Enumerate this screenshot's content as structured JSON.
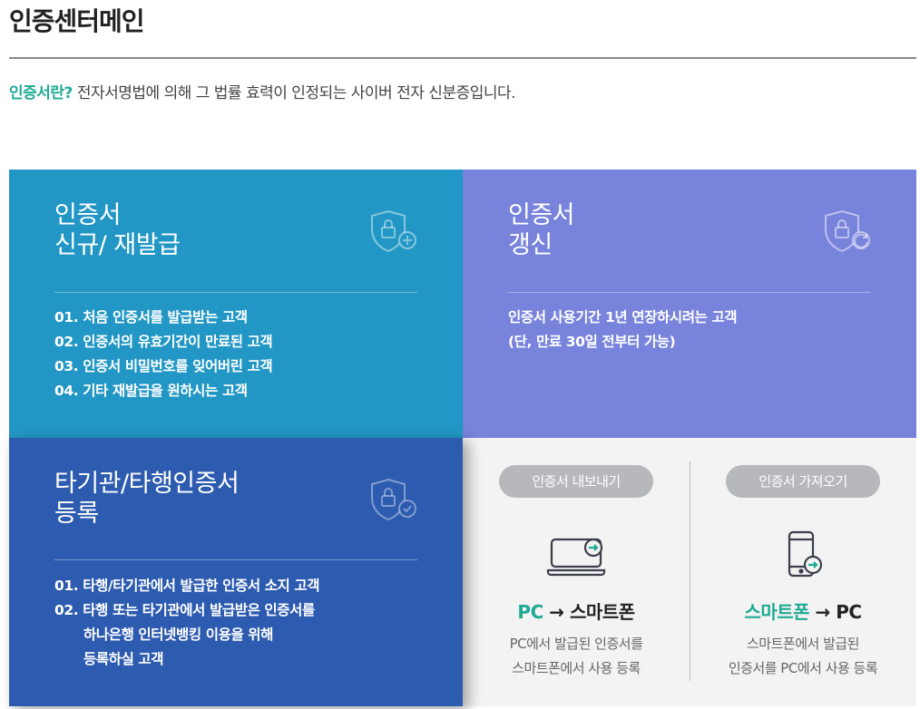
{
  "header": {
    "title": "인증센터메인",
    "intro_label": "인증서란?",
    "intro_text": " 전자서명법에 의해 그 법률 효력이 인정되는 사이버 전자 신분증입니다."
  },
  "cards": {
    "new": {
      "title_line1": "인증서",
      "title_line2": "신규/ 재발급",
      "items": [
        {
          "num": "01.",
          "text": "처음 인증서를 발급받는 고객"
        },
        {
          "num": "02.",
          "text": "인증서의 유효기간이 만료된 고객"
        },
        {
          "num": "03.",
          "text": "인증서 비밀번호를 잊어버린 고객"
        },
        {
          "num": "04.",
          "text": "기타 재발급을 원하시는 고객"
        }
      ]
    },
    "renew": {
      "title_line1": "인증서",
      "title_line2": "갱신",
      "lines": [
        "인증서 사용기간 1년 연장하시려는 고객",
        "(단, 만료 30일 전부터 가능)"
      ]
    },
    "register": {
      "title_line1": "타기관/타행인증서",
      "title_line2": "등록",
      "item1": {
        "num": "01.",
        "text": "타행/타기관에서 발급한 인증서 소지 고객"
      },
      "item2": {
        "num": "02.",
        "text": "타행 또는 타기관에서 발급받은 인증서를",
        "cont1": "하나은행 인터넷뱅킹 이용을 위해",
        "cont2": "등록하실 고객"
      }
    },
    "transfer": {
      "export": {
        "pill": "인증서 내보내기",
        "title_from": "PC",
        "arrow": " → ",
        "title_to": "스마트폰",
        "desc1": "PC에서 발급된 인증서를",
        "desc2": "스마트폰에서 사용 등록"
      },
      "import": {
        "pill": "인증서 가져오기",
        "title_from": "스마트폰",
        "arrow": " → ",
        "title_to": "PC",
        "desc1": "스마트폰에서 발급된",
        "desc2": "인증서를 PC에서 사용 등록"
      }
    }
  },
  "colors": {
    "accent_teal": "#1faa95",
    "card_new": "#2297c5",
    "card_renew": "#7883dc",
    "card_register": "#2d5baf",
    "card_transfer": "#f3f3f3"
  },
  "icons": {
    "new": "shield-lock-plus-icon",
    "renew": "shield-lock-refresh-icon",
    "register": "shield-lock-check-icon",
    "export": "laptop-arrow-icon",
    "import": "smartphone-arrow-icon"
  }
}
